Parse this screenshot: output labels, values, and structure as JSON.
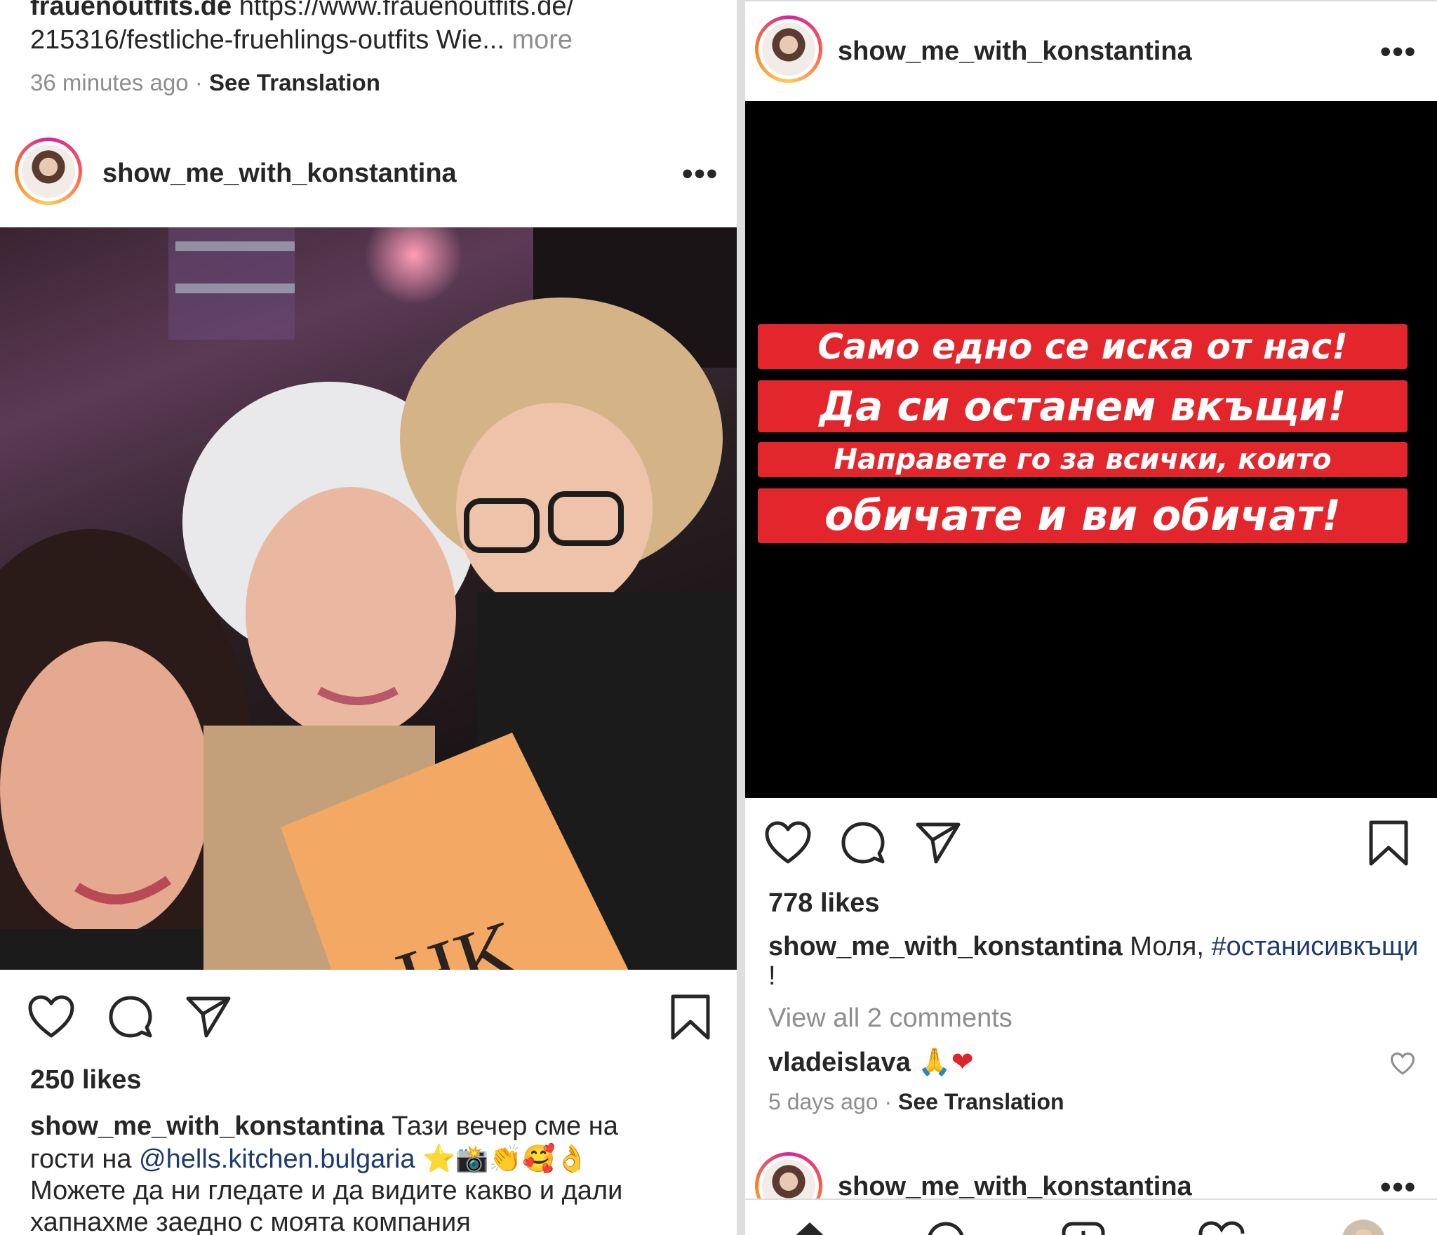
{
  "left": {
    "prev_caption": {
      "line1_user": "frauenoutfits.de",
      "line1_text": "https://www.frauenoutfits.de/",
      "line2_text": "215316/festliche-fruehlings-outfits Wie...",
      "more": "more",
      "time": "36 minutes ago",
      "sep": "·",
      "translation": "See Translation"
    },
    "post": {
      "username": "show_me_with_konstantina",
      "menu": "•••",
      "image_logo": "HK",
      "likes": "250 likes",
      "caption_user": "show_me_with_konstantina",
      "caption_line1": "Тази вечер сме на",
      "caption_line2_prefix": "гости на",
      "mention": "@hells.kitchen.bulgaria",
      "emojis": "⭐📸👏🥰👌",
      "caption_line3": "Можете да ни гледате и да видите какво и дали",
      "caption_line4": "хапнахме заедно с моята компания"
    }
  },
  "right": {
    "post": {
      "username": "show_me_with_konstantina",
      "menu": "•••",
      "banner_lines": [
        "Само едно се иска от нас!",
        "Да си останем вкъщи!",
        "Направете го за всички, които",
        "обичате и ви обичат!"
      ],
      "likes": "778 likes",
      "caption_user": "show_me_with_konstantina",
      "caption_text": "Моля,",
      "hashtag": "#останисивкъщи",
      "caption_end": "!",
      "view_comments": "View all 2 comments",
      "comment_user": "vladeislava",
      "comment_emojis": "🙏❤",
      "time": "5 days ago",
      "sep": "·",
      "translation": "See Translation"
    },
    "next_post": {
      "username": "show_me_with_konstantina",
      "menu": "•••"
    }
  },
  "colors": {
    "text": "#262626",
    "muted": "#8e8e8e",
    "link": "#1f3a6e",
    "banner_red": "#e3262c",
    "story_bg": "#000000"
  }
}
